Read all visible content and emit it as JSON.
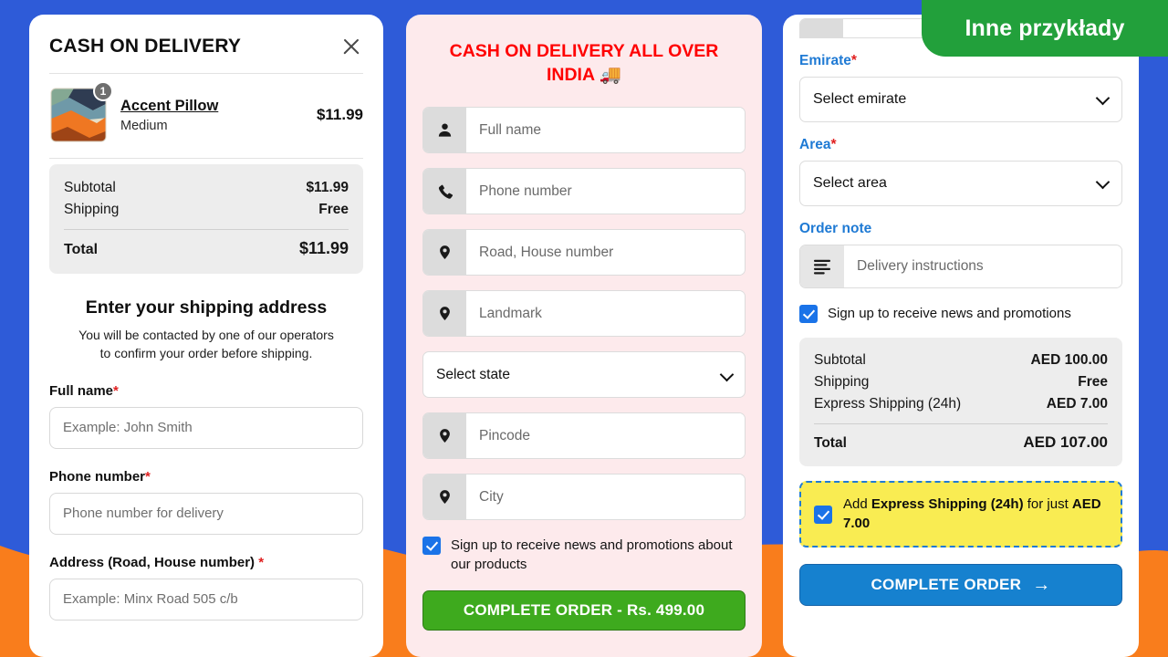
{
  "badge": {
    "label": "Inne przykłady",
    "color": "#22a03b"
  },
  "background": {
    "top_color": "#2e5bd8",
    "bottom_color": "#f97d1c"
  },
  "panel1": {
    "title": "CASH ON DELIVERY",
    "close_icon": "close-icon",
    "product": {
      "name": "Accent Pillow",
      "variant": "Medium",
      "price": "$11.99",
      "quantity": "1"
    },
    "totals": [
      {
        "label": "Subtotal",
        "value": "$11.99"
      },
      {
        "label": "Shipping",
        "value": "Free"
      }
    ],
    "grand_total": {
      "label": "Total",
      "value": "$11.99"
    },
    "shipping_heading": "Enter your shipping address",
    "shipping_subtext": "You will be contacted by one of our operators to confirm your order before shipping.",
    "fields": [
      {
        "label": "Full name",
        "required": "*",
        "placeholder": "Example: John Smith",
        "value": ""
      },
      {
        "label": "Phone number",
        "required": "*",
        "placeholder": "Phone number for delivery",
        "value": ""
      },
      {
        "label": "Address (Road, House number)",
        "required": "*",
        "placeholder": "Example: Minx Road 505 c/b",
        "value": ""
      }
    ]
  },
  "panel2": {
    "title": "CASH ON DELIVERY ALL OVER INDIA 🚚",
    "fields": [
      {
        "icon": "person-icon",
        "placeholder": "Full name",
        "value": ""
      },
      {
        "icon": "phone-icon",
        "placeholder": "Phone number",
        "value": ""
      },
      {
        "icon": "map-pin-icon",
        "placeholder": "Road, House number",
        "value": ""
      },
      {
        "icon": "map-pin-icon",
        "placeholder": "Landmark",
        "value": ""
      }
    ],
    "state_select": {
      "value": "Select state",
      "icon": "chevron-down-icon"
    },
    "fields2": [
      {
        "icon": "map-pin-icon",
        "placeholder": "Pincode",
        "value": ""
      },
      {
        "icon": "map-pin-icon",
        "placeholder": "City",
        "value": ""
      }
    ],
    "newsletter": {
      "label": "Sign up to receive news and promotions about our products",
      "checked": true
    },
    "submit_label": "COMPLETE ORDER - Rs. 499.00"
  },
  "panel3": {
    "emirate": {
      "label": "Emirate",
      "required": "*",
      "value": "Select emirate",
      "icon": "chevron-down-icon"
    },
    "area": {
      "label": "Area",
      "required": "*",
      "value": "Select area",
      "icon": "chevron-down-icon"
    },
    "order_note": {
      "label": "Order note",
      "icon": "lines-icon",
      "placeholder": "Delivery instructions",
      "value": ""
    },
    "newsletter": {
      "label": "Sign up to receive news and promotions",
      "checked": true
    },
    "totals": [
      {
        "label": "Subtotal",
        "value": "AED 100.00"
      },
      {
        "label": "Shipping",
        "value": "Free"
      },
      {
        "label": "Express Shipping (24h)",
        "value": "AED 7.00"
      }
    ],
    "grand_total": {
      "label": "Total",
      "value": "AED 107.00"
    },
    "upsell": {
      "checked": true,
      "prefix": "Add ",
      "bold1": "Express Shipping (24h)",
      "middle": " for just ",
      "bold2": "AED 7.00"
    },
    "submit_label": "COMPLETE ORDER",
    "submit_icon": "arrow-right-icon"
  }
}
